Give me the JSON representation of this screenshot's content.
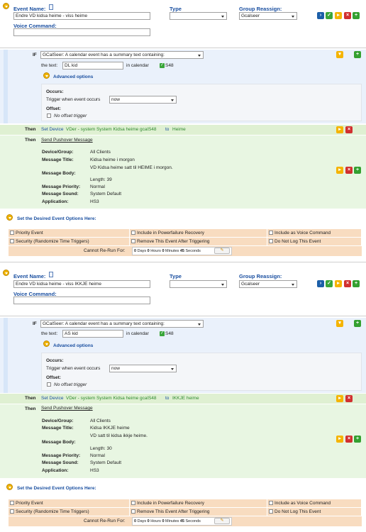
{
  "labels": {
    "event_name": "Event Name:",
    "type": "Type",
    "group_reassign": "Group Reassign:",
    "voice_command": "Voice Command:",
    "if": "IF",
    "the_text": "the text:",
    "in_calendar": "in calendar",
    "advanced_options": "Advanced options",
    "occurs": "Occurs:",
    "trigger_when": "Trigger when event occurs",
    "offset": "Offset:",
    "no_offset": "No offset trigger",
    "then": "Then",
    "device_group": "Device/Group:",
    "message_title": "Message Title:",
    "message_body": "Message Body:",
    "message_priority": "Message Priority:",
    "message_sound": "Message Sound:",
    "application": "Application:",
    "desired_options": "Set the Desired Event Options Here:",
    "priority_event": "Priority Event",
    "security": "Security (Randomize Time Triggers)",
    "include_powerfailure": "Include in Powerfailure Recovery",
    "remove_after_trigger": "Remove This Event After Triggering",
    "include_voice": "Include as Voice Command",
    "do_not_log": "Do Not Log This Event",
    "cannot_rerun": "Cannot Re-Run For:",
    "days": "Days",
    "hours": "Hours",
    "minutes": "Minutes",
    "seconds": "Seconds"
  },
  "events": [
    {
      "name": "Endre VD kidsa heime - viss heime",
      "type": "",
      "group": "Gcalseer",
      "voice": "",
      "trigger": "GCalSeer: A calendar event has a summary text containing:",
      "text": "DL kid",
      "calendar": "S48",
      "occurs": "now",
      "action1_prefix": "Set Device",
      "action1_device": "VDer - system System Kidsa heime gcalS48",
      "action1_to": "to",
      "action1_value": "Heime",
      "action2": "Send Pushover Message",
      "device_group": "All Clients",
      "title": "Kidsa heime i morgon",
      "body": "VD Kidsa heime satt til HEIME i morgon.",
      "length": "Length: 39",
      "priority": "Normal",
      "sound": "System Default",
      "app": "HS3",
      "rerun": {
        "days": "0",
        "hours": "0",
        "minutes": "0",
        "seconds": "45"
      }
    },
    {
      "name": "Endre VD kidsa heime - viss IKKJE heime",
      "type": "",
      "group": "Gcalseer",
      "voice": "",
      "trigger": "GCalSeer: A calendar event has a summary text containing:",
      "text": "AS kid",
      "calendar": "S48",
      "occurs": "now",
      "action1_prefix": "Set Device",
      "action1_device": "VDer - system System Kidsa heime gcalS48",
      "action1_to": "to",
      "action1_value": "IKKJE heime",
      "action2": "Send Pushover Message",
      "device_group": "All Clients",
      "title": "Kidsa IKKJE heime",
      "body": "VD satt til kidsa ikkje heime.",
      "length": "Length: 30",
      "priority": "Normal",
      "sound": "System Default",
      "app": "HS3",
      "rerun": {
        "days": "0",
        "hours": "0",
        "minutes": "0",
        "seconds": "45"
      }
    }
  ]
}
